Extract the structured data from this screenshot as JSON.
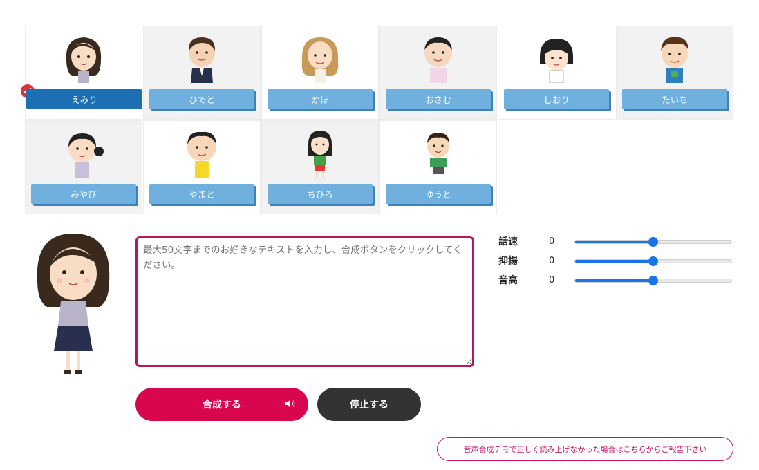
{
  "characters": [
    {
      "name": "えみり",
      "selected": true
    },
    {
      "name": "ひでと",
      "selected": false
    },
    {
      "name": "かほ",
      "selected": false
    },
    {
      "name": "おさむ",
      "selected": false
    },
    {
      "name": "しおり",
      "selected": false
    },
    {
      "name": "たいち",
      "selected": false
    },
    {
      "name": "みやび",
      "selected": false
    },
    {
      "name": "やまと",
      "selected": false
    },
    {
      "name": "ちひろ",
      "selected": false
    },
    {
      "name": "ゆうと",
      "selected": false
    }
  ],
  "text_input": {
    "placeholder": "最大50文字までのお好きなテキストを入力し、合成ボタンをクリックしてください。",
    "value": ""
  },
  "sliders": [
    {
      "label": "話速",
      "value": "0",
      "level": 0.5
    },
    {
      "label": "抑揚",
      "value": "0",
      "level": 0.5
    },
    {
      "label": "音高",
      "value": "0",
      "level": 0.5
    }
  ],
  "buttons": {
    "synthesize": "合成する",
    "stop": "停止する"
  },
  "report_link": "音声合成デモで正しく読み上げなかった場合はこちらからご報告下さい",
  "icons": {
    "check": "check-icon",
    "speaker": "speaker-icon"
  },
  "colors": {
    "selected_name": "#1c6fb3",
    "name_button": "#6fb0de",
    "synthesize": "#d7064e",
    "stop": "#333333",
    "accent_border": "#b5185a",
    "slider": "#1a73e8"
  }
}
